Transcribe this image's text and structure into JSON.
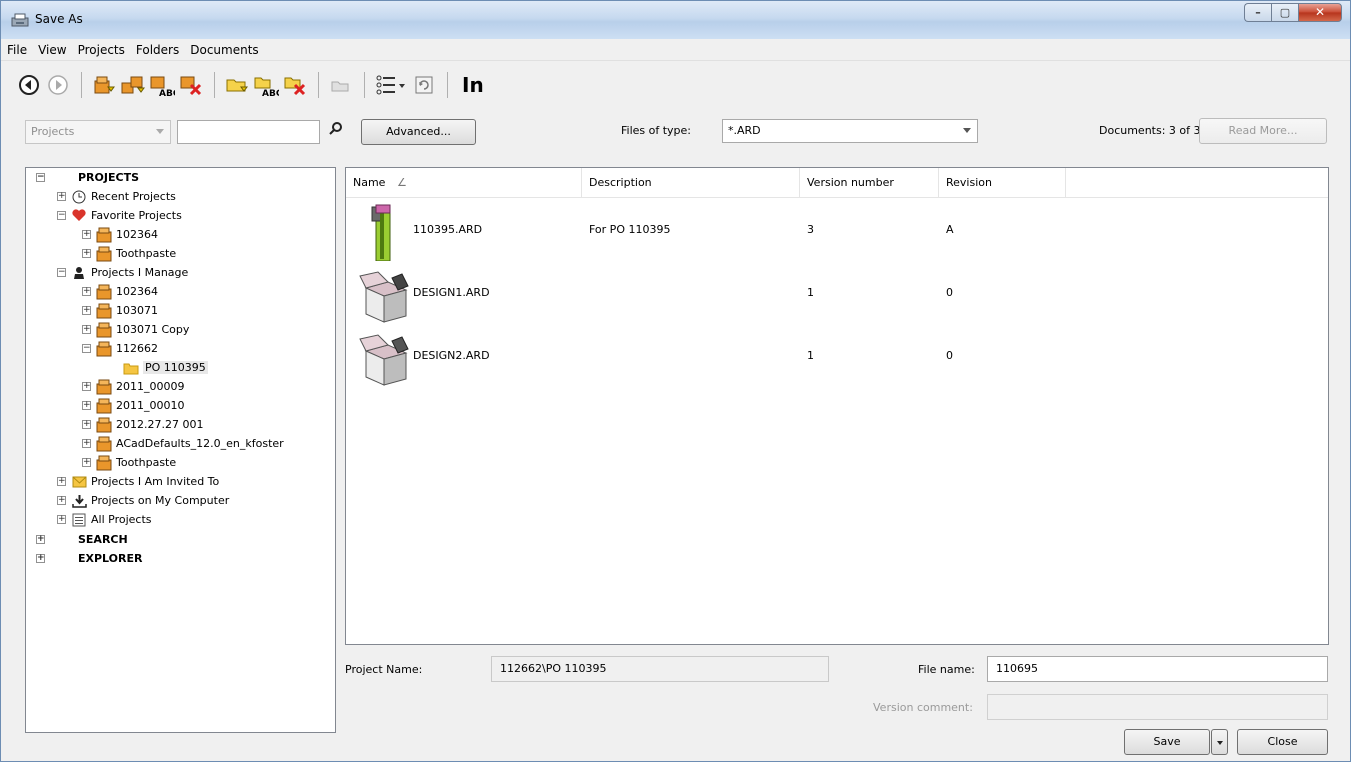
{
  "window": {
    "title": "Save As"
  },
  "menu": [
    "File",
    "View",
    "Projects",
    "Folders",
    "Documents"
  ],
  "toolbar": {
    "icons": [
      "back-icon",
      "forward-icon",
      "new-project-icon",
      "new-sub-project-icon",
      "rename-project-icon",
      "delete-project-icon",
      "new-folder-icon",
      "rename-folder-icon",
      "delete-folder-icon",
      "open-folder-icon",
      "view-options-icon",
      "refresh-icon"
    ],
    "text_button": "In"
  },
  "search": {
    "scope": "Projects",
    "query": "",
    "advanced_label": "Advanced...",
    "files_of_type_label": "Files of type:",
    "files_of_type_value": "*.ARD",
    "documents_count": "Documents: 3 of 3",
    "read_more_label": "Read More..."
  },
  "tree": {
    "projects": "PROJECTS",
    "recent": "Recent Projects",
    "favorites": "Favorite Projects",
    "fav_items": [
      "102364",
      "Toothpaste"
    ],
    "manage": "Projects I Manage",
    "manage_items": [
      "102364",
      "103071",
      "103071 Copy",
      "112662"
    ],
    "selected_folder": "PO 110395",
    "manage_items_after": [
      "2011_00009",
      "2011_00010",
      "2012.27.27 001",
      "ACadDefaults_12.0_en_kfoster",
      "Toothpaste"
    ],
    "invited": "Projects I Am Invited To",
    "my_computer": "Projects on My Computer",
    "all": "All Projects",
    "search": "SEARCH",
    "explorer": "EXPLORER"
  },
  "list": {
    "columns": [
      "Name",
      "Description",
      "Version number",
      "Revision"
    ],
    "rows": [
      {
        "name": "110395.ARD",
        "description": "For PO 110395",
        "version": "3",
        "revision": "A"
      },
      {
        "name": "DESIGN1.ARD",
        "description": "",
        "version": "1",
        "revision": "0"
      },
      {
        "name": "DESIGN2.ARD",
        "description": "",
        "version": "1",
        "revision": "0"
      }
    ]
  },
  "footer": {
    "project_name_label": "Project Name:",
    "project_name_value": "112662\\PO 110395",
    "file_name_label": "File name:",
    "file_name_value": "110695",
    "version_comment_label": "Version comment:",
    "version_comment_value": "",
    "save_label": "Save",
    "close_label": "Close"
  },
  "colors": {
    "folder": "#f5c542",
    "project_box": "#e9962b",
    "favorite": "#d9342b",
    "title_bar": "#c6d9ef",
    "close_button": "#c84a32"
  }
}
